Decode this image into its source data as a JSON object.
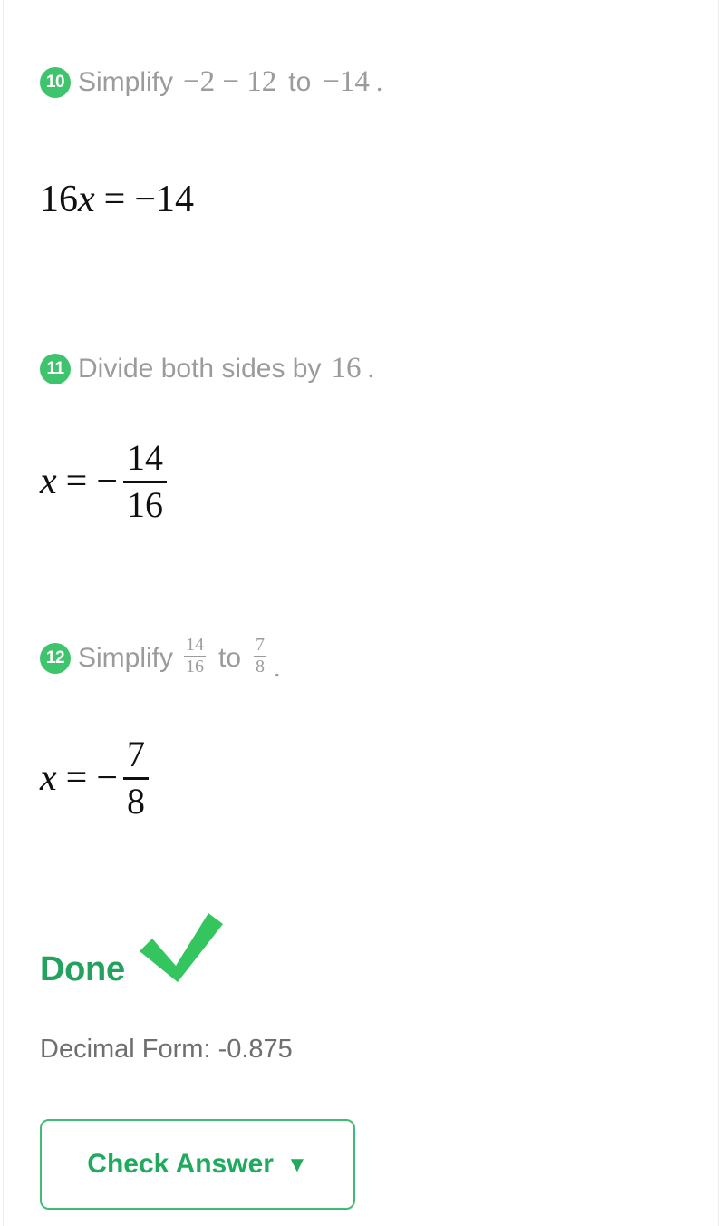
{
  "steps": [
    {
      "number": "10",
      "verb": "Simplify",
      "expr_from": "−2 − 12",
      "connector": "to",
      "expr_to": "−14",
      "period": ".",
      "result": {
        "lhs_coeff": "16",
        "lhs_var": "x",
        "equals": "=",
        "rhs": "−14"
      }
    },
    {
      "number": "11",
      "text_before": "Divide both sides by",
      "divisor": "16",
      "period": ".",
      "result": {
        "lhs_var": "x",
        "equals": "=",
        "sign": "−",
        "numerator": "14",
        "denominator": "16"
      }
    },
    {
      "number": "12",
      "verb": "Simplify",
      "frac_from": {
        "numerator": "14",
        "denominator": "16"
      },
      "connector": "to",
      "frac_to": {
        "numerator": "7",
        "denominator": "8"
      },
      "period": ".",
      "result": {
        "lhs_var": "x",
        "equals": "=",
        "sign": "−",
        "numerator": "7",
        "denominator": "8"
      }
    }
  ],
  "done": {
    "label": "Done",
    "icon": "check-mark-icon"
  },
  "decimal_form": "Decimal Form: -0.875",
  "check_button": {
    "label": "Check Answer",
    "caret": "▼"
  },
  "colors": {
    "badge_green": "#3ec46c",
    "check_green": "#35c55f",
    "done_green": "#22a25c",
    "button_border": "#3fbd77",
    "button_text": "#1faa5e",
    "step_text_gray": "#9b9b9b",
    "equation_black": "#101010",
    "decimal_gray": "#6f6f6f"
  }
}
